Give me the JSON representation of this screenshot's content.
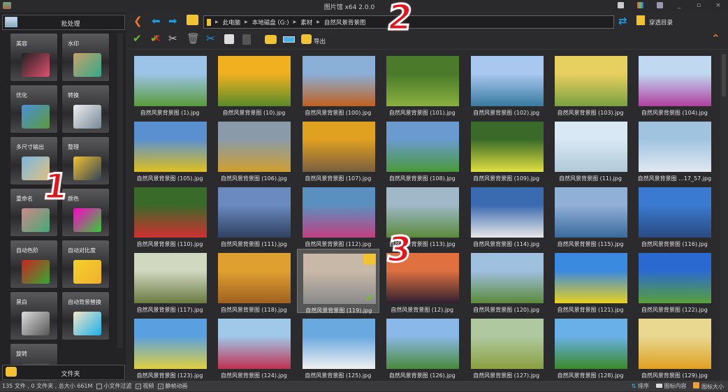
{
  "window": {
    "title": "图片馆 x64 2.0.0",
    "minimize": "_",
    "maximize": "▫",
    "close": "×"
  },
  "left_panel": {
    "header": "批处理",
    "tools": [
      {
        "label": "美容",
        "colors": [
          "#222",
          "#e05070"
        ]
      },
      {
        "label": "水印",
        "colors": [
          "#c9a06a",
          "#3a8"
        ]
      },
      {
        "label": "优化",
        "colors": [
          "#4a90d9",
          "#5c9a3a"
        ]
      },
      {
        "label": "转换",
        "colors": [
          "#eee",
          "#789"
        ]
      },
      {
        "label": "多尺寸输出",
        "colors": [
          "#7ab8e0",
          "#e0c080"
        ]
      },
      {
        "label": "整理",
        "colors": [
          "#f1c232",
          "#345"
        ]
      },
      {
        "label": "重命名",
        "colors": [
          "#c88",
          "#4a7"
        ]
      },
      {
        "label": "颜色",
        "colors": [
          "#f0c",
          "#3c3"
        ]
      },
      {
        "label": "自动色阶",
        "colors": [
          "#c22",
          "#3a3"
        ]
      },
      {
        "label": "自动对比度",
        "colors": [
          "#f4d02a",
          "#f0b030"
        ]
      },
      {
        "label": "黑白",
        "colors": [
          "#ddd",
          "#555"
        ]
      },
      {
        "label": "自动背景替换",
        "colors": [
          "#f5e6c8",
          "#1ab0e8"
        ]
      },
      {
        "label": "旋转",
        "colors": [
          "#444",
          "#555"
        ]
      }
    ],
    "footer": "文件夹"
  },
  "toolbar": {
    "address": [
      "此电脑",
      "本地磁盘 (G:)",
      "素材",
      "自然风景背景图"
    ],
    "through_dir": "穿透目录",
    "export": "导出"
  },
  "colors": {
    "accent_orange": "#e8782a",
    "nav_blue": "#1e9be0",
    "check_green": "#6cc02a",
    "annotation_red": "#e4141c"
  },
  "annotations": [
    "1",
    "2",
    "3"
  ],
  "thumbnails": [
    {
      "name": "自然风景背景图 (1).jpg",
      "c": [
        "#9cc4e8",
        "#5a9a3a"
      ]
    },
    {
      "name": "自然风景背景图 (10).jpg",
      "c": [
        "#f0b020",
        "#5a8a2a"
      ]
    },
    {
      "name": "自然风景背景图 (100).jpg",
      "c": [
        "#8ab0d8",
        "#c06020"
      ]
    },
    {
      "name": "自然风景背景图 (101).jpg",
      "c": [
        "#4a7a2a",
        "#8ab040"
      ]
    },
    {
      "name": "自然风景背景图 (102).jpg",
      "c": [
        "#a8c8f0",
        "#3a7aa0"
      ]
    },
    {
      "name": "自然风景背景图 (103).jpg",
      "c": [
        "#e8d060",
        "#7aa040"
      ]
    },
    {
      "name": "自然风景背景图 (104).jpg",
      "c": [
        "#c0d8f0",
        "#b040a0"
      ]
    },
    {
      "name": "自然风景背景图 (105).jpg",
      "c": [
        "#5a90d0",
        "#e0c020"
      ]
    },
    {
      "name": "自然风景背景图 (106).jpg",
      "c": [
        "#8a9aa8",
        "#d0a030"
      ]
    },
    {
      "name": "自然风景背景图 (107).jpg",
      "c": [
        "#e0a020",
        "#7a6040"
      ]
    },
    {
      "name": "自然风景背景图 (108).jpg",
      "c": [
        "#6a9ad0",
        "#4a9a3a"
      ]
    },
    {
      "name": "自然风景背景图 (109).jpg",
      "c": [
        "#3a6a2a",
        "#e0e040"
      ]
    },
    {
      "name": "自然风景背景图 (11).jpg",
      "c": [
        "#d8e8f4",
        "#b0c8d8"
      ]
    },
    {
      "name": "自然风景背景图 ...17_57.jpg",
      "c": [
        "#a0c4e0",
        "#e0e8f0"
      ]
    },
    {
      "name": "自然风景背景图 (110).jpg",
      "c": [
        "#3a6a2a",
        "#d03030"
      ]
    },
    {
      "name": "自然风景背景图 (111).jpg",
      "c": [
        "#6a8ac0",
        "#304060"
      ]
    },
    {
      "name": "自然风景背景图 (112).jpg",
      "c": [
        "#5a90c0",
        "#c04080"
      ]
    },
    {
      "name": "自然风景背景图 (113).jpg",
      "c": [
        "#a0b8c8",
        "#5a8a3a"
      ]
    },
    {
      "name": "自然风景背景图 (114).jpg",
      "c": [
        "#3a6ab0",
        "#e8e8e8"
      ]
    },
    {
      "name": "自然风景背景图 (115).jpg",
      "c": [
        "#90b0d8",
        "#3a6a9a"
      ]
    },
    {
      "name": "自然风景背景图 (116).jpg",
      "c": [
        "#3a7ad0",
        "#2a4a80"
      ]
    },
    {
      "name": "自然风景背景图 (117).jpg",
      "c": [
        "#d0d8c0",
        "#6a7a40"
      ]
    },
    {
      "name": "自然风景背景图 (118).jpg",
      "c": [
        "#e0a030",
        "#a06020"
      ]
    },
    {
      "name": "自然风景背景图 (119).jpg",
      "c": [
        "#c8b8a8",
        "#8a8a8a"
      ]
    },
    {
      "name": "自然风景背景图 (12).jpg",
      "c": [
        "#e07040",
        "#302030"
      ]
    },
    {
      "name": "自然风景背景图 (120).jpg",
      "c": [
        "#a0c0e0",
        "#5a8a3a"
      ]
    },
    {
      "name": "自然风景背景图 (121).jpg",
      "c": [
        "#3a8ae0",
        "#e8d020"
      ]
    },
    {
      "name": "自然风景背景图 (122).jpg",
      "c": [
        "#2a6ad0",
        "#5aa03a"
      ]
    },
    {
      "name": "自然风景背景图 (123).jpg",
      "c": [
        "#5aa0e0",
        "#e0d040"
      ]
    },
    {
      "name": "自然风景背景图 (124).jpg",
      "c": [
        "#a0c8e8",
        "#c03050"
      ]
    },
    {
      "name": "自然风景背景图 (125).jpg",
      "c": [
        "#6aa8e0",
        "#f0f0f0"
      ]
    },
    {
      "name": "自然风景背景图 (126).jpg",
      "c": [
        "#8ab8e8",
        "#4a8a3a"
      ]
    },
    {
      "name": "自然风景背景图 (127).jpg",
      "c": [
        "#b0c8a0",
        "#8aa040"
      ]
    },
    {
      "name": "自然风景背景图 (128).jpg",
      "c": [
        "#6ab0e8",
        "#3a8a2a"
      ]
    },
    {
      "name": "自然风景背景图 (129).jpg",
      "c": [
        "#e8d890",
        "#e0a020"
      ]
    }
  ],
  "selected_index": 23,
  "status": {
    "summary": "135 文件 , 0 文件夹 , 总大小 661M",
    "small_filter": "小文件过滤",
    "small_filter_checked": false,
    "video": "视频",
    "video_checked": true,
    "animation": "静帧动画",
    "animation_checked": true,
    "sort": "排序",
    "icon_content": "图标内容",
    "icon_size": "图标大小"
  }
}
